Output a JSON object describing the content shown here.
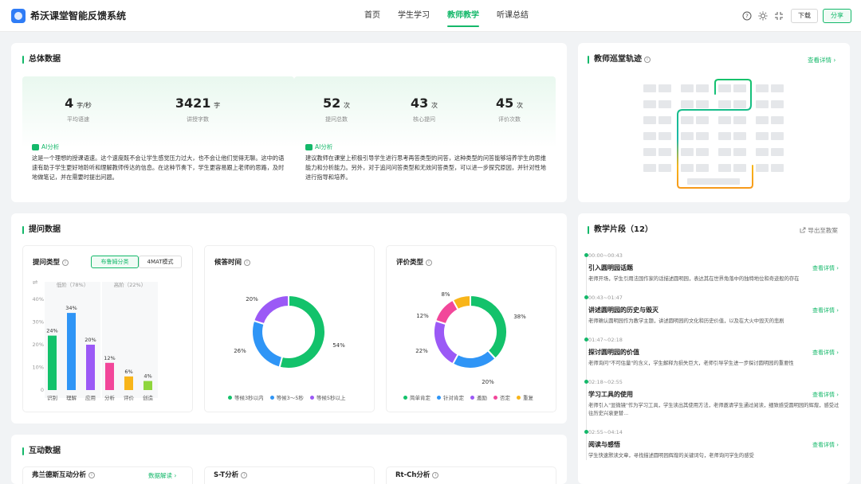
{
  "header": {
    "app_title": "希沃课堂智能反馈系统",
    "nav": [
      "首页",
      "学生学习",
      "教师教学",
      "听课总结"
    ],
    "active_nav": 2,
    "download_label": "下载",
    "share_label": "分享"
  },
  "overview": {
    "title": "总体数据",
    "left": {
      "stats": [
        {
          "value": "4",
          "unit": "字/秒",
          "label": "平均语速"
        },
        {
          "value": "3421",
          "unit": "字",
          "label": "讲授字数"
        }
      ],
      "ai_label": "AI分析",
      "ai_text": "这是一个理想的授课语速。这个速度既不会让学生感觉压力过大，也不会让他们觉得无聊。这中的语速有助于学生更好地聆听和理解教师传达的信息。在这种节奏下，学生更容易跟上老师的思路，及时地做笔记，并在需要时提出问题。"
    },
    "right": {
      "stats": [
        {
          "value": "52",
          "unit": "次",
          "label": "提问总数"
        },
        {
          "value": "43",
          "unit": "次",
          "label": "核心提问"
        },
        {
          "value": "45",
          "unit": "次",
          "label": "评价次数"
        }
      ],
      "ai_label": "AI分析",
      "ai_text": "建议教师在课堂上积极引导学生进行思考再答类型的问答，这种类型的问答能够培养学生的思维能力和分析能力。另外，对于追问问答类型和无效问答类型，可以进一步探究原因，并针对性地进行指导和培养。"
    }
  },
  "patrol": {
    "title": "教师巡堂轨迹",
    "link": "查看详情 ›"
  },
  "questions": {
    "title": "提问数据",
    "type_card": {
      "title": "提问类型",
      "toggle_on": "布鲁姆分类",
      "toggle_off": "4MAT模式"
    },
    "wait_card": {
      "title": "候答时间"
    },
    "eval_card": {
      "title": "评价类型"
    }
  },
  "segments": {
    "title": "教学片段（12）",
    "export": "导出至教案",
    "link_label": "查看详情 ›",
    "items": [
      {
        "time": "00:00~00:43",
        "name": "引入圆明园话题",
        "desc": "老师开场，学生引用法国作家的话描述圆明园，表达其在世界角落中的独特地位和奇迹般的存在"
      },
      {
        "time": "00:43~01:47",
        "name": "讲述圆明园的历史与毁灭",
        "desc": "老师确认圆明园作为教学主题，讲述圆明园的文化和历史价值，以及在大火中毁灭的悲剧"
      },
      {
        "time": "01:47~02:18",
        "name": "探讨圆明园的价值",
        "desc": "老师询问\"不可估量\"的含义，学生解释为损失巨大，老师引导学生进一步探讨圆明园的重要性"
      },
      {
        "time": "02:18~02:55",
        "name": "学习工具的使用",
        "desc": "老师引入\"显微镜\"作为学习工具，学生读出其使用方法，老师邀请学生通过阅读，细致感受圆明园的辉煌，感受过往历史兴衰更替..."
      },
      {
        "time": "02:55~04:14",
        "name": "阅读与感悟",
        "desc": "学生快速默读文章，寻找描述圆明园辉煌的关键词句，老师询问学生的感受"
      }
    ]
  },
  "interaction": {
    "title": "互动数据",
    "cards": [
      "弗兰德斯互动分析",
      "S-T分析",
      "Rt-Ch分析"
    ],
    "link": "数据解读 ›"
  },
  "chart_data": [
    {
      "type": "bar",
      "groups": [
        {
          "label": "低阶（78%）"
        },
        {
          "label": "高阶（22%）"
        }
      ],
      "categories": [
        "识别",
        "理解",
        "应用",
        "分析",
        "评价",
        "创造"
      ],
      "values": [
        24,
        34,
        20,
        12,
        6,
        4
      ],
      "value_labels": [
        "24%",
        "34%",
        "20%",
        "12%",
        "6%",
        "4%"
      ],
      "colors": [
        "#13c26b",
        "#2f95f6",
        "#9b59f6",
        "#f2479a",
        "#f8b51a",
        "#8fd63c"
      ],
      "yticks": [
        "0",
        "10%",
        "20%",
        "30%",
        "40%"
      ],
      "ylim": [
        0,
        40
      ]
    },
    {
      "type": "pie",
      "labels": [
        "等候3秒以内",
        "等候3～5秒",
        "等候5秒以上"
      ],
      "values": [
        54,
        26,
        20
      ],
      "value_labels": [
        "54%",
        "26%",
        "20%"
      ],
      "colors": [
        "#13c26b",
        "#2f95f6",
        "#9b59f6"
      ]
    },
    {
      "type": "pie",
      "labels": [
        "简单肯定",
        "针对肯定",
        "邀励",
        "否定",
        "重复"
      ],
      "values": [
        38,
        20,
        22,
        12,
        8
      ],
      "value_labels": [
        "38%",
        "20%",
        "22%",
        "12%",
        "8%"
      ],
      "colors": [
        "#13c26b",
        "#2f95f6",
        "#9b59f6",
        "#f2479a",
        "#f8b51a"
      ]
    }
  ]
}
